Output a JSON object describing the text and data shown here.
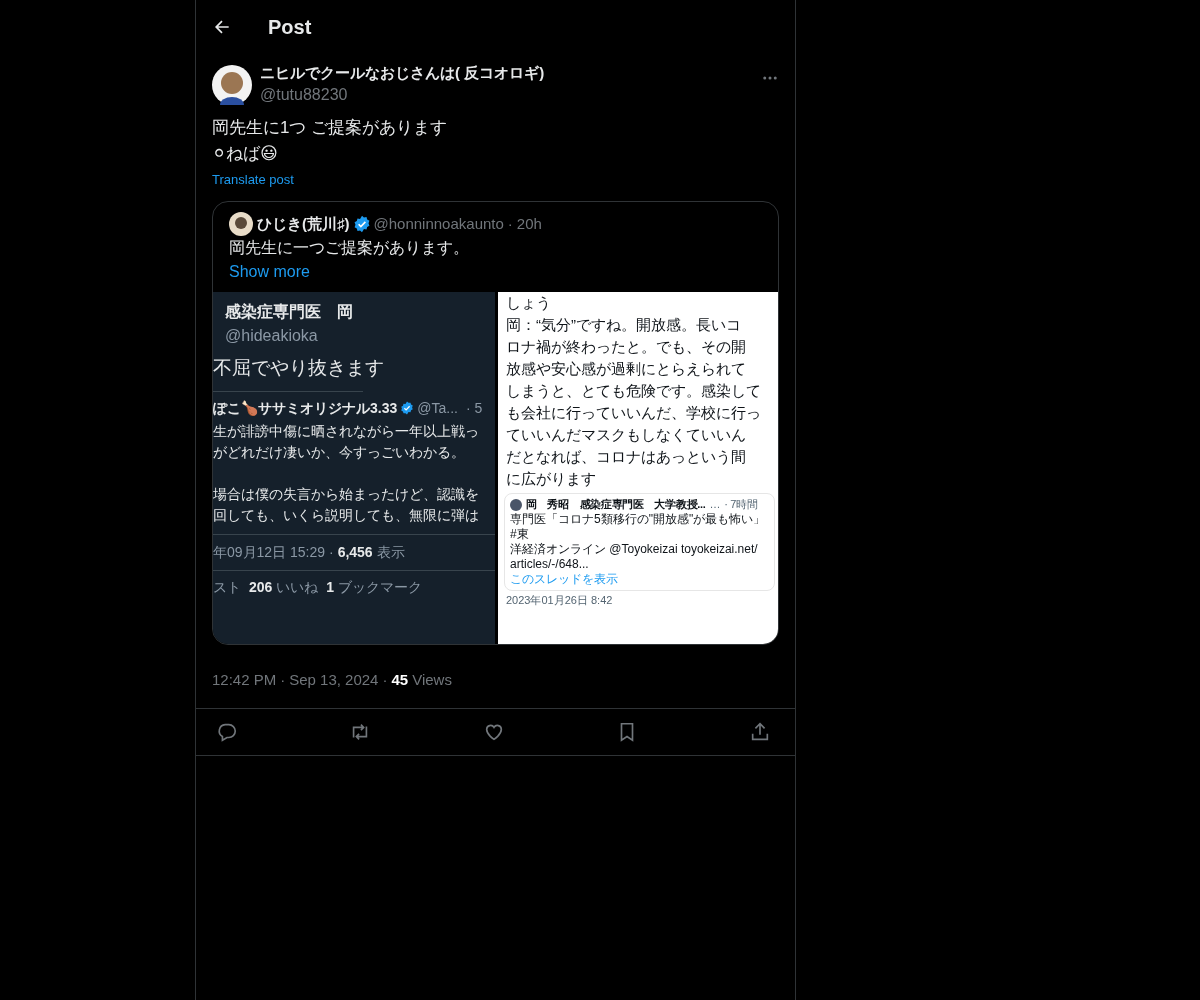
{
  "header": {
    "title": "Post"
  },
  "post": {
    "author": {
      "name": "ニヒルでクールなおじさんは( 反コオロギ)",
      "handle": "@tutu88230"
    },
    "text_lines": [
      "岡先生に1つ ご提案があります",
      "⚪ねば😃"
    ],
    "translate": "Translate post",
    "quote": {
      "author": {
        "name": "ひじき(荒川♯)",
        "verified": true,
        "handle": "@honninnoakaunto",
        "dot": "·",
        "time": "20h"
      },
      "text": "岡先生に一つご提案があります。",
      "show_more": "Show more",
      "images": [
        {
          "kind": "dark_tweet",
          "name": "感染症専門医　岡",
          "handle": "@hideakioka",
          "text": "不屈でやり抜きます",
          "inner": {
            "name": "ぽこ🍗ササミオリジナル3.33",
            "verified": true,
            "handle": "@Ta...",
            "time": "· 5",
            "paragraphs": [
              [
                "生が誹謗中傷に晒されながら一年以上戦っ",
                "がどれだけ凄いか、今すっごいわかる。"
              ],
              [
                "場合は僕の失言から始まったけど、認識を",
                "回しても、いくら説明しても、無限に弾は"
              ]
            ]
          },
          "date": "年09月12日 15:29 ·",
          "views": "6,456",
          "views_label": "表示",
          "stats": [
            {
              "label": "スト"
            },
            {
              "count": "206",
              "label": "いいね"
            },
            {
              "count": "1",
              "label": "ブックマーク"
            }
          ]
        },
        {
          "kind": "light_tweet",
          "lines": [
            "しょう",
            "岡：“気分”ですね。開放感。長いコ",
            "ロナ禍が終わったと。でも、その開",
            "放感や安心感が過剰にとらえられて",
            "しまうと、とても危険です。感染して",
            "も会社に行っていいんだ、学校に行っ",
            "ていいんだマスクもしなくていいん",
            "だとなれば、コロナはあっという間",
            "に広がります"
          ],
          "card": {
            "name": "岡　秀昭　感染症専門医　大学教授...",
            "more": "…",
            "time": "· 7時間",
            "lines": [
              "専門医「コロナ5類移行の\"開放感\"が最も怖い」#東",
              "洋経済オンライン @Toyokeizai toyokeizai.net/",
              "articles/-/648..."
            ],
            "link": "このスレッドを表示"
          },
          "date": "2023年01月26日 8:42"
        }
      ]
    },
    "timestamp": {
      "parts": [
        "12:42 PM",
        "·",
        "Sep 13, 2024",
        "·"
      ],
      "views": "45",
      "views_label": "Views"
    },
    "actions": [
      {
        "kind": "reply"
      },
      {
        "kind": "repost"
      },
      {
        "kind": "like"
      },
      {
        "kind": "bookmark"
      },
      {
        "kind": "share"
      }
    ]
  }
}
